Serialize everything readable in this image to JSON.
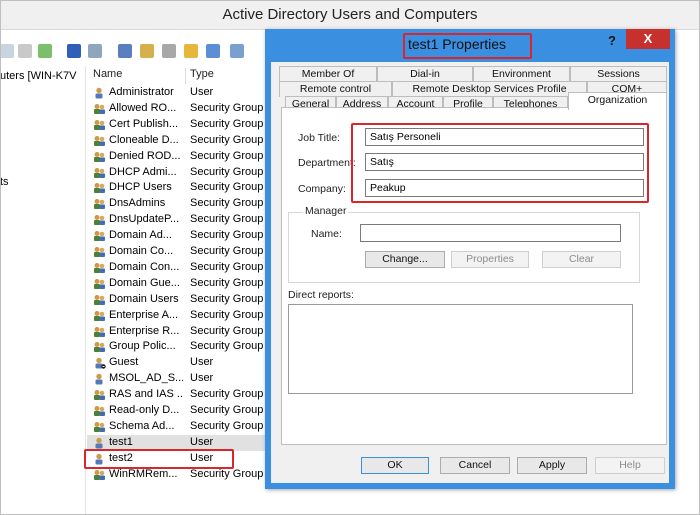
{
  "main_window": {
    "title": "Active Directory Users and Computers"
  },
  "tree": {
    "root_label": "uters [WIN-K7V",
    "item2_label": "ts"
  },
  "list": {
    "columns": [
      "Name",
      "Type"
    ],
    "rows": [
      {
        "name": "Administrator",
        "type": "User",
        "icon": "user-icon"
      },
      {
        "name": "Allowed RO...",
        "type": "Security Group",
        "icon": "group-icon"
      },
      {
        "name": "Cert Publish...",
        "type": "Security Group",
        "icon": "group-icon"
      },
      {
        "name": "Cloneable D...",
        "type": "Security Group",
        "icon": "group-icon"
      },
      {
        "name": "Denied ROD...",
        "type": "Security Group",
        "icon": "group-icon"
      },
      {
        "name": "DHCP Admi...",
        "type": "Security Group",
        "icon": "group-icon"
      },
      {
        "name": "DHCP Users",
        "type": "Security Group",
        "icon": "group-icon"
      },
      {
        "name": "DnsAdmins",
        "type": "Security Group",
        "icon": "group-icon"
      },
      {
        "name": "DnsUpdateP...",
        "type": "Security Group",
        "icon": "group-icon"
      },
      {
        "name": "Domain Ad...",
        "type": "Security Group",
        "icon": "group-icon"
      },
      {
        "name": "Domain Co...",
        "type": "Security Group",
        "icon": "group-icon"
      },
      {
        "name": "Domain Con...",
        "type": "Security Group",
        "icon": "group-icon"
      },
      {
        "name": "Domain Gue...",
        "type": "Security Group",
        "icon": "group-icon"
      },
      {
        "name": "Domain Users",
        "type": "Security Group",
        "icon": "group-icon"
      },
      {
        "name": "Enterprise A...",
        "type": "Security Group",
        "icon": "group-icon"
      },
      {
        "name": "Enterprise R...",
        "type": "Security Group",
        "icon": "group-icon"
      },
      {
        "name": "Group Polic...",
        "type": "Security Group",
        "icon": "group-icon"
      },
      {
        "name": "Guest",
        "type": "User",
        "icon": "user-disabled-icon"
      },
      {
        "name": "MSOL_AD_S...",
        "type": "User",
        "icon": "user-icon"
      },
      {
        "name": "RAS and IAS ...",
        "type": "Security Group",
        "icon": "group-icon"
      },
      {
        "name": "Read-only D...",
        "type": "Security Group",
        "icon": "group-icon"
      },
      {
        "name": "Schema Ad...",
        "type": "Security Group",
        "icon": "group-icon"
      },
      {
        "name": "test1",
        "type": "User",
        "icon": "user-icon"
      },
      {
        "name": "test2",
        "type": "User",
        "icon": "user-icon"
      },
      {
        "name": "WinRMRem...",
        "type": "Security Group",
        "icon": "group-icon"
      }
    ]
  },
  "dialog": {
    "title": "test1 Properties",
    "help_label": "?",
    "close_label": "X",
    "tabs_row1": [
      "Member Of",
      "Dial-in",
      "Environment",
      "Sessions"
    ],
    "tabs_row2": [
      "Remote control",
      "Remote Desktop Services Profile",
      "COM+"
    ],
    "tabs_row3": [
      "General",
      "Address",
      "Account",
      "Profile",
      "Telephones",
      "Organization"
    ],
    "active_tab": "Organization",
    "job_title_label": "Job Title:",
    "job_title_value": "Satış Personeli",
    "department_label": "Department:",
    "department_value": "Satış",
    "company_label": "Company:",
    "company_value": "Peakup",
    "manager_group_label": "Manager",
    "manager_name_label": "Name:",
    "manager_name_value": "",
    "change_button": "Change...",
    "properties_button": "Properties",
    "clear_button": "Clear",
    "direct_reports_label": "Direct reports:",
    "ok_button": "OK",
    "cancel_button": "Cancel",
    "apply_button": "Apply",
    "help_button": "Help"
  },
  "colors": {
    "dialog_frame": "#3a8fe0",
    "close_button": "#c7312d",
    "highlight_box": "#d9262d"
  }
}
